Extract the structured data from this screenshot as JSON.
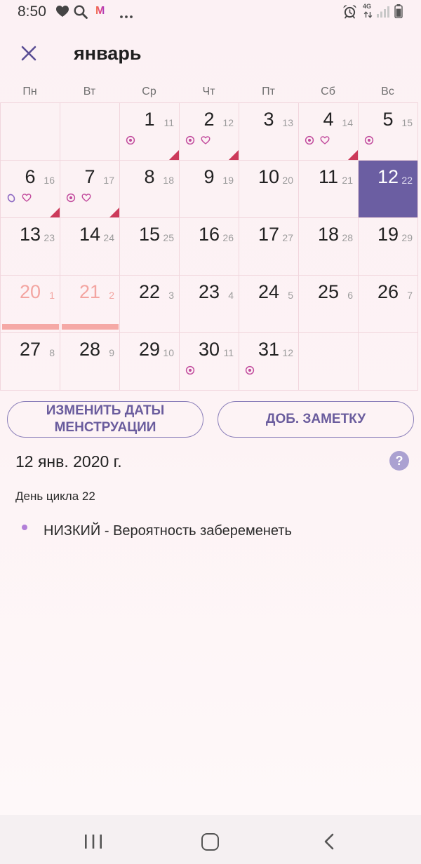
{
  "colors": {
    "page_bg": "#fdf3f5",
    "accent": "#6a5c9d",
    "today_bg": "#6b5ea2",
    "period": "#f3a5a1",
    "grid_line": "#f1d6dd",
    "symptom_icon": "#c24c9d",
    "note_flag": "#cc3a5a",
    "help_bg": "#aba1d1",
    "bullet": "#b27fd8"
  },
  "status_bar": {
    "time": "8:50",
    "app_letter": "M",
    "network_type": "4G",
    "left_icons": [
      "heart-icon",
      "search-icon",
      "app-icon",
      "more-dots-icon"
    ],
    "right_icons": [
      "alarm-icon",
      "network-icon",
      "signal-icon",
      "battery-icon"
    ]
  },
  "header": {
    "close_icon": "close-icon",
    "month_title": "январь"
  },
  "weekdays": [
    "Пн",
    "Вт",
    "Ср",
    "Чт",
    "Пт",
    "Сб",
    "Вс"
  ],
  "calendar": {
    "weeks": [
      [
        null,
        null,
        {
          "day": "1",
          "cycle_day": "11",
          "icons": [
            "dot-circle-icon"
          ],
          "has_note": true
        },
        {
          "day": "2",
          "cycle_day": "12",
          "icons": [
            "dot-circle-icon",
            "heart-icon"
          ],
          "has_note": true
        },
        {
          "day": "3",
          "cycle_day": "13",
          "icons": []
        },
        {
          "day": "4",
          "cycle_day": "14",
          "icons": [
            "dot-circle-icon",
            "heart-icon"
          ],
          "has_note": true
        },
        {
          "day": "5",
          "cycle_day": "15",
          "icons": [
            "dot-circle-icon"
          ]
        }
      ],
      [
        {
          "day": "6",
          "cycle_day": "16",
          "icons": [
            "oval-icon",
            "heart-icon"
          ],
          "has_note": true
        },
        {
          "day": "7",
          "cycle_day": "17",
          "icons": [
            "dot-circle-icon",
            "heart-icon"
          ],
          "has_note": true
        },
        {
          "day": "8",
          "cycle_day": "18"
        },
        {
          "day": "9",
          "cycle_day": "19"
        },
        {
          "day": "10",
          "cycle_day": "20"
        },
        {
          "day": "11",
          "cycle_day": "21"
        },
        {
          "day": "12",
          "cycle_day": "22",
          "is_today": true
        }
      ],
      [
        {
          "day": "13",
          "cycle_day": "23"
        },
        {
          "day": "14",
          "cycle_day": "24"
        },
        {
          "day": "15",
          "cycle_day": "25"
        },
        {
          "day": "16",
          "cycle_day": "26"
        },
        {
          "day": "17",
          "cycle_day": "27"
        },
        {
          "day": "18",
          "cycle_day": "28"
        },
        {
          "day": "19",
          "cycle_day": "29"
        }
      ],
      [
        {
          "day": "20",
          "cycle_day": "1",
          "is_period_day": true
        },
        {
          "day": "21",
          "cycle_day": "2",
          "is_period_day": true
        },
        {
          "day": "22",
          "cycle_day": "3"
        },
        {
          "day": "23",
          "cycle_day": "4"
        },
        {
          "day": "24",
          "cycle_day": "5"
        },
        {
          "day": "25",
          "cycle_day": "6"
        },
        {
          "day": "26",
          "cycle_day": "7"
        }
      ],
      [
        {
          "day": "27",
          "cycle_day": "8"
        },
        {
          "day": "28",
          "cycle_day": "9"
        },
        {
          "day": "29",
          "cycle_day": "10"
        },
        {
          "day": "30",
          "cycle_day": "11",
          "icons": [
            "dot-circle-icon"
          ]
        },
        {
          "day": "31",
          "cycle_day": "12",
          "icons": [
            "dot-circle-icon"
          ]
        },
        null,
        null
      ]
    ]
  },
  "actions": {
    "edit_period_label": "ИЗМЕНИТЬ ДАТЫ МЕНСТРУАЦИИ",
    "add_note_label": "ДОБ. ЗАМЕТКУ"
  },
  "details": {
    "selected_date": "12 янв. 2020 г.",
    "help_glyph": "?",
    "cycle_day_text": "День цикла 22",
    "pregnancy_chance": "НИЗКИЙ - Вероятность забеременеть"
  },
  "nav_bar": {
    "icons": [
      "recent-apps-icon",
      "home-icon",
      "back-icon"
    ]
  }
}
